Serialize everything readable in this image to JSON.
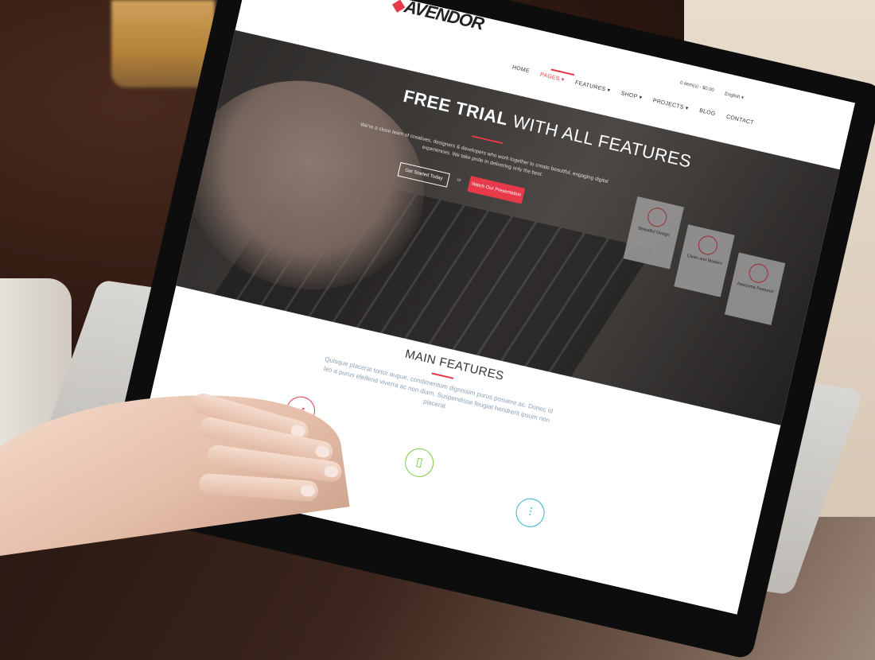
{
  "site": {
    "logo": "AVENDOR",
    "nav": [
      "HOME",
      "PAGES ▾",
      "FEATURES ▾",
      "SHOP ▾",
      "PROJECTS ▾",
      "BLOG",
      "CONTACT"
    ],
    "topbar": {
      "cart": "0 item(s) - $0.00",
      "language": "English ▾"
    }
  },
  "hero": {
    "title_bold": "FREE TRIAL",
    "title_rest": "WITH ALL FEATURES",
    "subtitle": "We're a close team of creatives, designers & developers who work together to create beautiful, engaging digital experiences. We take pride in delivering only the best.",
    "btn_primary": "Get Started Today",
    "or_text": "or",
    "btn_secondary": "Watch Our Presentation",
    "cards": [
      "Beautiful Design",
      "Clean and Modern",
      "Awesome Features"
    ]
  },
  "features": {
    "title": "MAIN FEATURES",
    "text": "Quisque placerat tortor augue, condimentum dignissim purus posuere ac. Donec id leo a purus eleifend viverra ac non diam. Suspendisse feugiat hendrerit ipsum non placerat",
    "icons": [
      "rocket-icon",
      "mobile-icon",
      "sliders-icon"
    ]
  },
  "colors": {
    "accent": "#e8394a",
    "green": "#7ac943",
    "cyan": "#29b8cf"
  }
}
